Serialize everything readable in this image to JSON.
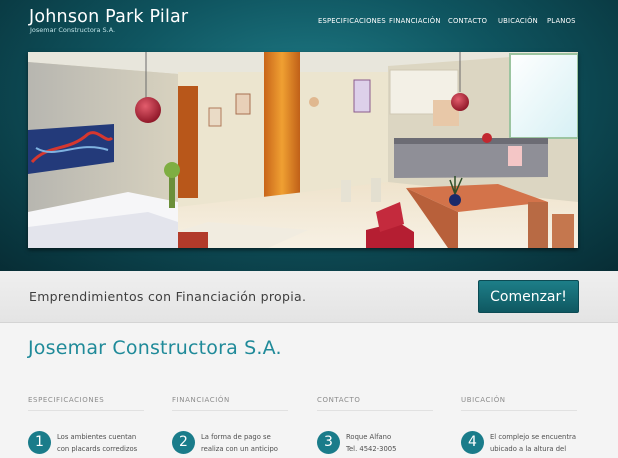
{
  "header": {
    "title": "Johnson Park Pilar",
    "subtitle": "Josemar Constructora S.A.",
    "nav": [
      "ESPECIFICACIONES",
      "FINANCIACIÓN",
      "CONTACTO",
      "UBICACIÓN",
      "PLANOS"
    ]
  },
  "cta": {
    "text": "Emprendimientos con Financiación propia.",
    "button_label": "Comenzar!"
  },
  "main": {
    "company_title": "Josemar Constructora S.A.",
    "columns": [
      {
        "heading": "ESPECIFICACIONES",
        "number": "1",
        "lines": [
          "Los ambientes cuentan",
          "con placards corredizos"
        ]
      },
      {
        "heading": "FINANCIACIÓN",
        "number": "2",
        "lines": [
          "La forma de pago se",
          "realiza con un anticipo"
        ]
      },
      {
        "heading": "CONTACTO",
        "number": "3",
        "lines": [
          "Roque Alfano",
          "Tel. 4542-3005"
        ]
      },
      {
        "heading": "UBICACIÓN",
        "number": "4",
        "lines": [
          "El complejo se encuentra",
          "ubicado a la altura del"
        ]
      }
    ]
  },
  "colors": {
    "header_teal": "#0f5560",
    "accent": "#1a7c8a",
    "title_teal": "#1f8a99"
  }
}
